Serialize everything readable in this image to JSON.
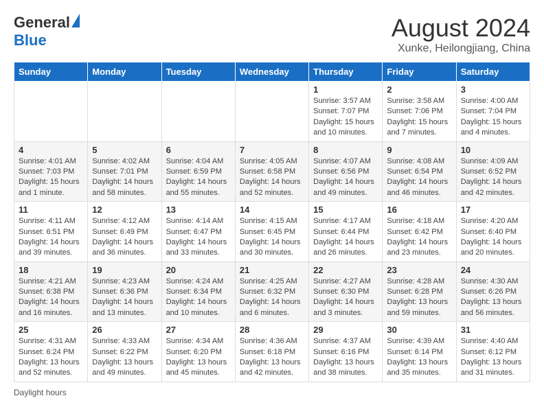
{
  "header": {
    "logo_general": "General",
    "logo_blue": "Blue",
    "month_title": "August 2024",
    "location": "Xunke, Heilongjiang, China"
  },
  "days_of_week": [
    "Sunday",
    "Monday",
    "Tuesday",
    "Wednesday",
    "Thursday",
    "Friday",
    "Saturday"
  ],
  "footer": {
    "daylight_label": "Daylight hours"
  },
  "weeks": [
    {
      "days": [
        {
          "number": "",
          "info": ""
        },
        {
          "number": "",
          "info": ""
        },
        {
          "number": "",
          "info": ""
        },
        {
          "number": "",
          "info": ""
        },
        {
          "number": "1",
          "info": "Sunrise: 3:57 AM\nSunset: 7:07 PM\nDaylight: 15 hours and 10 minutes."
        },
        {
          "number": "2",
          "info": "Sunrise: 3:58 AM\nSunset: 7:06 PM\nDaylight: 15 hours and 7 minutes."
        },
        {
          "number": "3",
          "info": "Sunrise: 4:00 AM\nSunset: 7:04 PM\nDaylight: 15 hours and 4 minutes."
        }
      ]
    },
    {
      "days": [
        {
          "number": "4",
          "info": "Sunrise: 4:01 AM\nSunset: 7:03 PM\nDaylight: 15 hours and 1 minute."
        },
        {
          "number": "5",
          "info": "Sunrise: 4:02 AM\nSunset: 7:01 PM\nDaylight: 14 hours and 58 minutes."
        },
        {
          "number": "6",
          "info": "Sunrise: 4:04 AM\nSunset: 6:59 PM\nDaylight: 14 hours and 55 minutes."
        },
        {
          "number": "7",
          "info": "Sunrise: 4:05 AM\nSunset: 6:58 PM\nDaylight: 14 hours and 52 minutes."
        },
        {
          "number": "8",
          "info": "Sunrise: 4:07 AM\nSunset: 6:56 PM\nDaylight: 14 hours and 49 minutes."
        },
        {
          "number": "9",
          "info": "Sunrise: 4:08 AM\nSunset: 6:54 PM\nDaylight: 14 hours and 46 minutes."
        },
        {
          "number": "10",
          "info": "Sunrise: 4:09 AM\nSunset: 6:52 PM\nDaylight: 14 hours and 42 minutes."
        }
      ]
    },
    {
      "days": [
        {
          "number": "11",
          "info": "Sunrise: 4:11 AM\nSunset: 6:51 PM\nDaylight: 14 hours and 39 minutes."
        },
        {
          "number": "12",
          "info": "Sunrise: 4:12 AM\nSunset: 6:49 PM\nDaylight: 14 hours and 36 minutes."
        },
        {
          "number": "13",
          "info": "Sunrise: 4:14 AM\nSunset: 6:47 PM\nDaylight: 14 hours and 33 minutes."
        },
        {
          "number": "14",
          "info": "Sunrise: 4:15 AM\nSunset: 6:45 PM\nDaylight: 14 hours and 30 minutes."
        },
        {
          "number": "15",
          "info": "Sunrise: 4:17 AM\nSunset: 6:44 PM\nDaylight: 14 hours and 26 minutes."
        },
        {
          "number": "16",
          "info": "Sunrise: 4:18 AM\nSunset: 6:42 PM\nDaylight: 14 hours and 23 minutes."
        },
        {
          "number": "17",
          "info": "Sunrise: 4:20 AM\nSunset: 6:40 PM\nDaylight: 14 hours and 20 minutes."
        }
      ]
    },
    {
      "days": [
        {
          "number": "18",
          "info": "Sunrise: 4:21 AM\nSunset: 6:38 PM\nDaylight: 14 hours and 16 minutes."
        },
        {
          "number": "19",
          "info": "Sunrise: 4:23 AM\nSunset: 6:36 PM\nDaylight: 14 hours and 13 minutes."
        },
        {
          "number": "20",
          "info": "Sunrise: 4:24 AM\nSunset: 6:34 PM\nDaylight: 14 hours and 10 minutes."
        },
        {
          "number": "21",
          "info": "Sunrise: 4:25 AM\nSunset: 6:32 PM\nDaylight: 14 hours and 6 minutes."
        },
        {
          "number": "22",
          "info": "Sunrise: 4:27 AM\nSunset: 6:30 PM\nDaylight: 14 hours and 3 minutes."
        },
        {
          "number": "23",
          "info": "Sunrise: 4:28 AM\nSunset: 6:28 PM\nDaylight: 13 hours and 59 minutes."
        },
        {
          "number": "24",
          "info": "Sunrise: 4:30 AM\nSunset: 6:26 PM\nDaylight: 13 hours and 56 minutes."
        }
      ]
    },
    {
      "days": [
        {
          "number": "25",
          "info": "Sunrise: 4:31 AM\nSunset: 6:24 PM\nDaylight: 13 hours and 52 minutes."
        },
        {
          "number": "26",
          "info": "Sunrise: 4:33 AM\nSunset: 6:22 PM\nDaylight: 13 hours and 49 minutes."
        },
        {
          "number": "27",
          "info": "Sunrise: 4:34 AM\nSunset: 6:20 PM\nDaylight: 13 hours and 45 minutes."
        },
        {
          "number": "28",
          "info": "Sunrise: 4:36 AM\nSunset: 6:18 PM\nDaylight: 13 hours and 42 minutes."
        },
        {
          "number": "29",
          "info": "Sunrise: 4:37 AM\nSunset: 6:16 PM\nDaylight: 13 hours and 38 minutes."
        },
        {
          "number": "30",
          "info": "Sunrise: 4:39 AM\nSunset: 6:14 PM\nDaylight: 13 hours and 35 minutes."
        },
        {
          "number": "31",
          "info": "Sunrise: 4:40 AM\nSunset: 6:12 PM\nDaylight: 13 hours and 31 minutes."
        }
      ]
    }
  ]
}
